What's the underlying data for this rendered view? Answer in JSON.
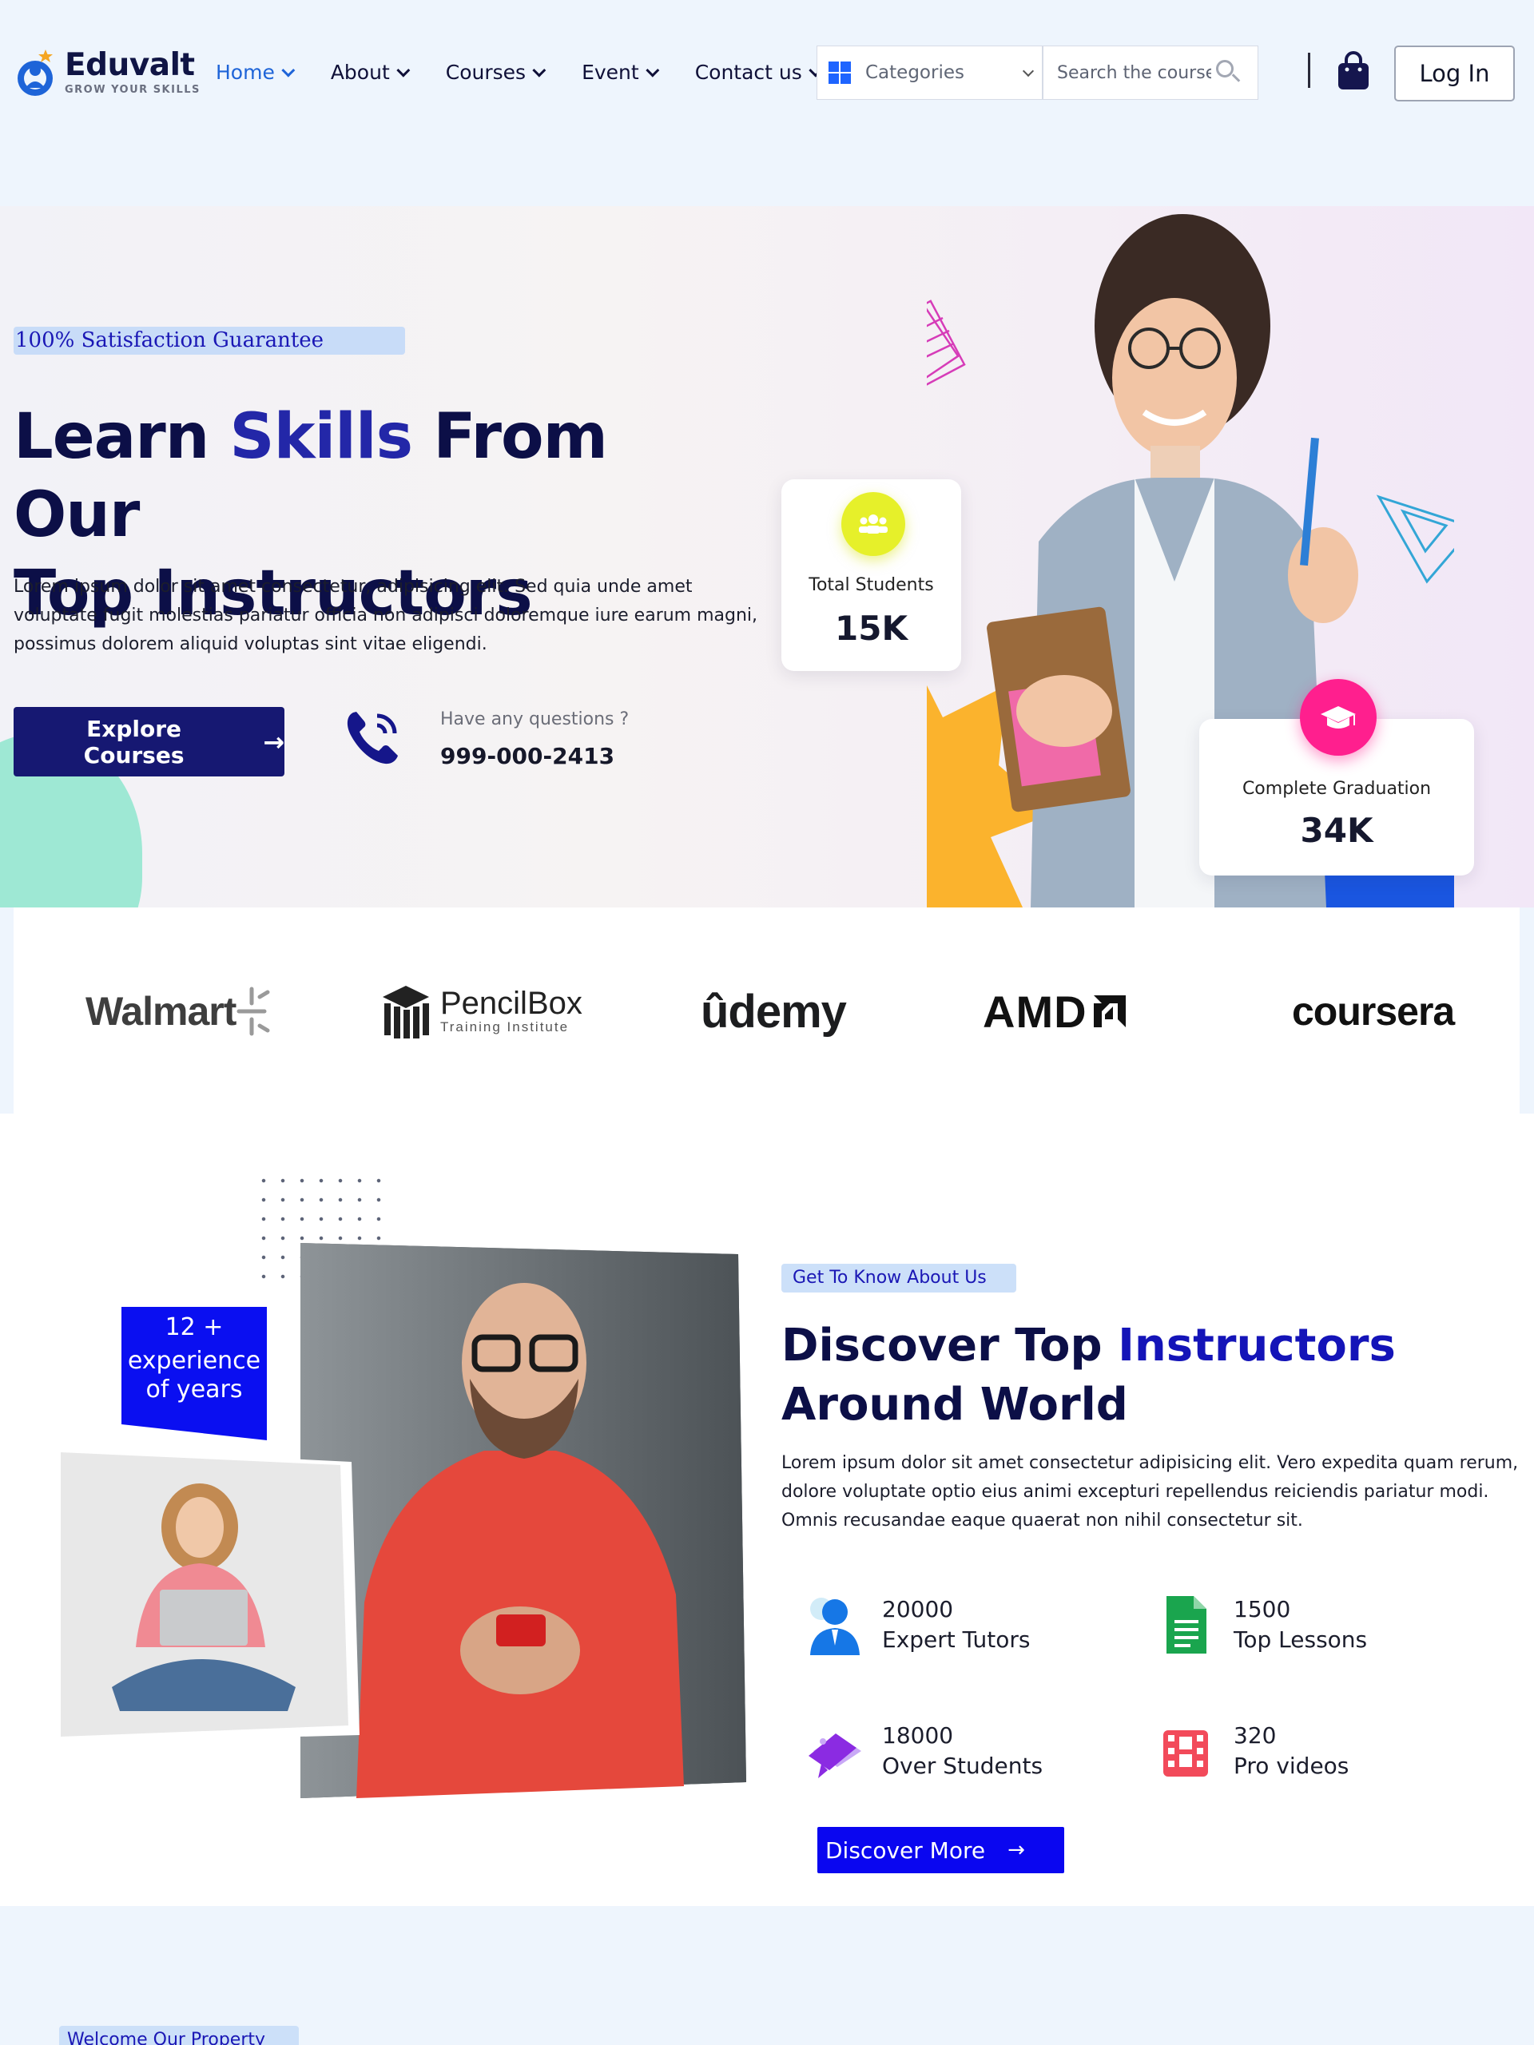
{
  "brand": {
    "name": "Eduvalt",
    "tagline": "GROW YOUR SKILLS"
  },
  "nav": {
    "items": [
      {
        "label": "Home",
        "active": true
      },
      {
        "label": "About",
        "active": false
      },
      {
        "label": "Courses",
        "active": false
      },
      {
        "label": "Event",
        "active": false
      },
      {
        "label": "Contact us",
        "active": false
      }
    ]
  },
  "header": {
    "categories_label": "Categories",
    "search_placeholder": "Search the course..",
    "login_label": "Log In"
  },
  "hero": {
    "badge": "100% Satisfaction Guarantee",
    "title_part1": "Learn ",
    "title_accent": "Skills",
    "title_part2": " From Our",
    "title_line2": "Top Instructors",
    "description": "Lorem ipsum dolor sit amet consectetur, adipisicing elit. Sed quia unde amet voluptate fugit molestias pariatur officia non adipisci doloremque iure earum magni, possimus dolorem aliquid voluptas sint vitae eligendi.",
    "cta_label": "Explore Courses",
    "question_label": "Have any questions ?",
    "phone": "999-000-2413",
    "stats": {
      "students_label": "Total Students",
      "students_value": "15K",
      "graduation_label": "Complete Graduation",
      "graduation_value": "34K"
    }
  },
  "partners": {
    "walmart": "Walmart",
    "pencilbox": "PencilBox",
    "pencilbox_sub": "Training Institute",
    "udemy": "ûdemy",
    "amd": "AMD",
    "coursera": "coursera"
  },
  "about": {
    "experience_line1": "12 +",
    "experience_line2": "experience",
    "experience_line3": "of years",
    "badge": "Get To Know About Us",
    "title_part1": "Discover Top ",
    "title_accent": "Instructors",
    "title_line2": "Around World",
    "description": "Lorem ipsum dolor sit amet consectetur adipisicing elit. Vero expedita quam rerum, dolore voluptate optio eius animi excepturi repellendus reiciendis pariatur modi. Omnis recusandae eaque quaerat non nihil consectetur sit.",
    "features": [
      {
        "value": "20000",
        "label": "Expert Tutors",
        "icon": "tutor-icon"
      },
      {
        "value": "1500",
        "label": "Top Lessons",
        "icon": "document-icon"
      },
      {
        "value": "18000",
        "label": "Over Students",
        "icon": "graduation-cap-icon"
      },
      {
        "value": "320",
        "label": "Pro videos",
        "icon": "film-icon"
      }
    ],
    "cta_label": "Discover More"
  },
  "next_section": {
    "badge": "Welcome Our Property"
  },
  "colors": {
    "primary_dark": "#161872",
    "accent_blue": "#0a06f0",
    "nav_active": "#1e64d8",
    "badge_bg": "#cce0f9",
    "students_badge": "#e6f02a",
    "graduation_badge": "#ff1f8e"
  }
}
